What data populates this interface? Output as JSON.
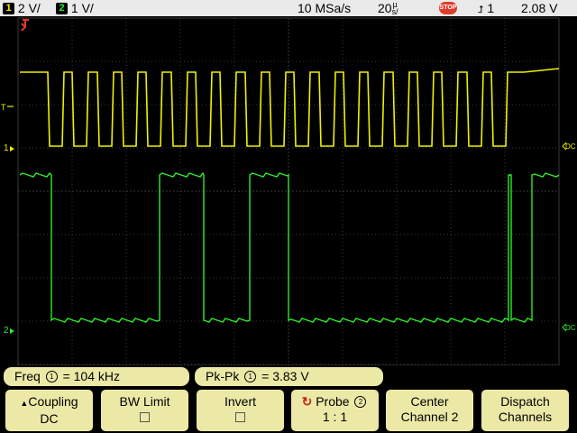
{
  "status": {
    "ch1_num": "1",
    "ch1_scale": "2 V/",
    "ch2_num": "2",
    "ch2_scale": "1 V/",
    "sample_rate": "10 MSa/s",
    "timebase_value": "20",
    "timebase_unit_top": "µ",
    "timebase_unit_bottom": "s/",
    "run_state": "STOP",
    "trigger_icon": "trigger-edge-icon",
    "trigger_slope_symbol": "⮥",
    "trigger_source": "1",
    "trigger_level": "2.08 V"
  },
  "display": {
    "ch1_color": "#f0f000",
    "ch2_color": "#2eea2e",
    "ch1_marker": "1",
    "ch2_marker": "2",
    "trigger_marker": "T",
    "dc_label": "DC",
    "grid_color": "#3a3a3a"
  },
  "measurements": {
    "freq_label": "Freq",
    "freq_channel": "1",
    "freq_value": "= 104 kHz",
    "pkpk_label": "Pk-Pk",
    "pkpk_channel": "1",
    "pkpk_value": "=   3.83  V"
  },
  "softkeys": {
    "coupling_line1": "Coupling",
    "coupling_line2": "DC",
    "bwlimit_line1": "BW Limit",
    "invert_line1": "Invert",
    "probe_line1": "Probe",
    "probe_channel": "2",
    "probe_line2": "1 : 1",
    "center_line1": "Center",
    "center_line2": "Channel 2",
    "dispatch_line1": "Dispatch",
    "dispatch_line2": "Channels"
  }
}
